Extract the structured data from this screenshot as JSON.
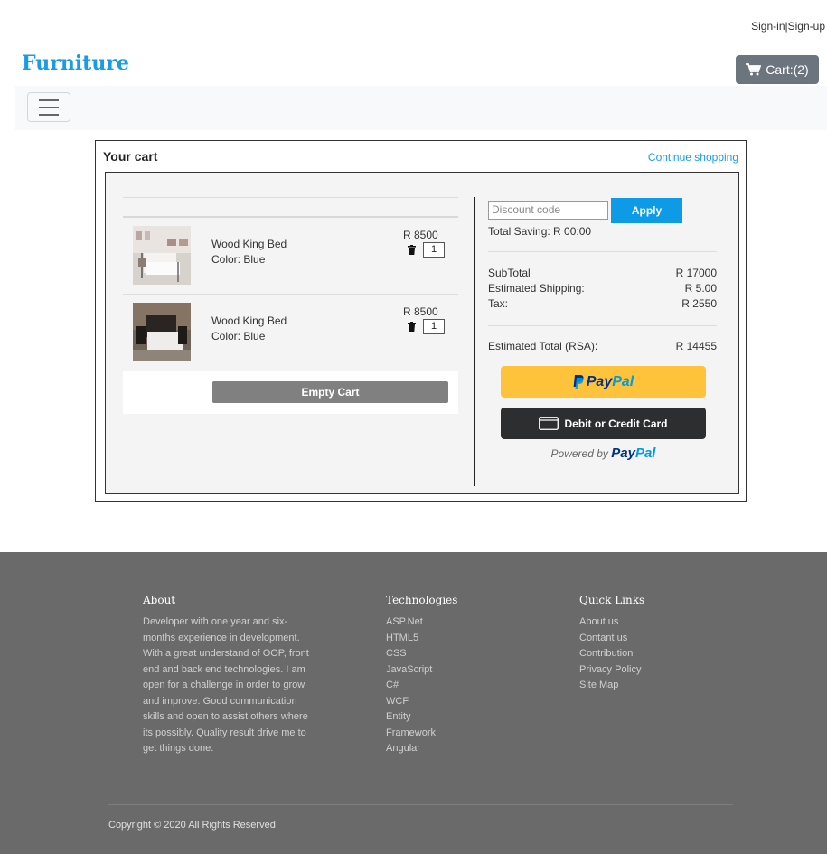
{
  "header": {
    "sign_in": "Sign-in",
    "separator": "|",
    "sign_up": "Sign-up",
    "brand": "Furniture",
    "cart_label": "Cart:(2)"
  },
  "cart": {
    "title": "Your cart",
    "continue_label": "Continue shopping",
    "items": [
      {
        "name": "Wood King Bed",
        "color": "Color: Blue",
        "price": "R 8500",
        "qty": "1"
      },
      {
        "name": "Wood King Bed",
        "color": "Color: Blue",
        "price": "R 8500",
        "qty": "1"
      }
    ],
    "empty_label": "Empty Cart"
  },
  "summary": {
    "discount_placeholder": "Discount code",
    "apply_label": "Apply",
    "total_saving": "Total Saving: R 00:00",
    "subtotal_label": "SubTotal",
    "subtotal_value": "R 17000",
    "shipping_label": "Estimated Shipping:",
    "shipping_value": "R 5.00",
    "tax_label": "Tax:",
    "tax_value": "R 2550",
    "total_label": "Estimated Total (RSA):",
    "total_value": "R 14455",
    "paypal_p1": "Pay",
    "paypal_p2": "Pal",
    "card_label": "Debit or Credit Card",
    "powered_by": "Powered by",
    "powered_p1": "Pay",
    "powered_p2": "Pal"
  },
  "footer": {
    "about_title": "About",
    "about_text": "Developer with one year and six-months experience in development. With a great understand of OOP, front end and back end technologies. I am open for a challenge in order to grow and improve. Good communication skills and open to assist others where its possibly. Quality result drive me to get things done.",
    "tech_title": "Technologies",
    "tech_items": [
      "ASP.Net",
      "HTML5",
      "CSS",
      "JavaScript",
      "C#",
      "WCF",
      "Entity",
      "Framework",
      "Angular"
    ],
    "links_title": "Quick Links",
    "links": [
      "About us",
      "Contant us",
      "Contribution",
      "Privacy Policy",
      "Site Map"
    ],
    "copyright": "Copyright © 2020 All Rights Reserved"
  },
  "colors": {
    "brand": "#1a9be6",
    "apply": "#0d9be8",
    "paypal_yellow": "#ffc33b",
    "paypal_dark_blue": "#003087",
    "paypal_light_blue": "#009cde",
    "footer_bg": "#6a6a6a"
  },
  "icons": [
    "shopping-cart-icon",
    "hamburger-menu-icon",
    "trash-icon",
    "paypal-p-icon",
    "credit-card-icon"
  ]
}
